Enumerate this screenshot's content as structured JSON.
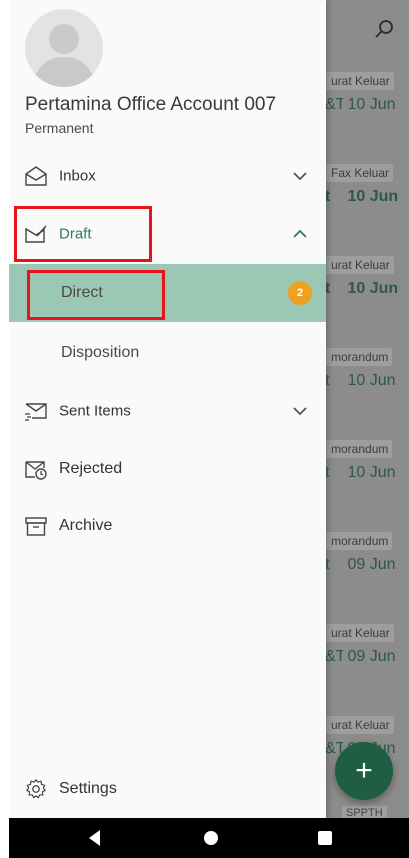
{
  "account": {
    "name": "Pertamina Office Account 007",
    "type": "Permanent"
  },
  "nav": {
    "inbox": {
      "label": "Inbox",
      "icon": "inbox-envelope-icon"
    },
    "draft": {
      "label": "Draft",
      "icon": "draft-envelope-pen-icon",
      "expanded": true,
      "children": [
        {
          "label": "Direct",
          "badge": "2",
          "active": true
        },
        {
          "label": "Disposition"
        }
      ]
    },
    "sent": {
      "label": "Sent Items",
      "icon": "sent-envelope-icon"
    },
    "rejected": {
      "label": "Rejected",
      "icon": "rejected-envelope-icon"
    },
    "archive": {
      "label": "Archive",
      "icon": "archive-box-icon"
    },
    "settings": {
      "label": "Settings",
      "icon": "gear-icon"
    }
  },
  "background_list": [
    {
      "tag": "urat Keluar",
      "date_prefix": "&T",
      "date": "10 Jun",
      "bold": false
    },
    {
      "tag": "Fax Keluar",
      "date_prefix": "t",
      "date": "10 Jun",
      "bold": true
    },
    {
      "tag": "urat Keluar",
      "date_prefix": "t",
      "date": "10 Jun",
      "bold": true
    },
    {
      "tag": "morandum",
      "date_prefix": "t",
      "date": "10 Jun",
      "bold": false
    },
    {
      "tag": "morandum",
      "date_prefix": "t",
      "date": "10 Jun",
      "bold": false
    },
    {
      "tag": "morandum",
      "date_prefix": "t",
      "date": "09 Jun",
      "bold": false
    },
    {
      "tag": "urat Keluar",
      "date_prefix": "&T",
      "date": "09 Jun",
      "bold": false
    },
    {
      "tag": "urat Keluar",
      "date_prefix": "&T",
      "date": "09 Jun",
      "bold": false
    }
  ],
  "background_bottom_tag": "SPPTH",
  "fab_symbol": "+",
  "colors": {
    "accent_green": "#2f7a5a",
    "active_bg": "#9bc8b4",
    "badge": "#f0a020",
    "highlight": "#e8141c",
    "fab": "#1f5e43"
  }
}
